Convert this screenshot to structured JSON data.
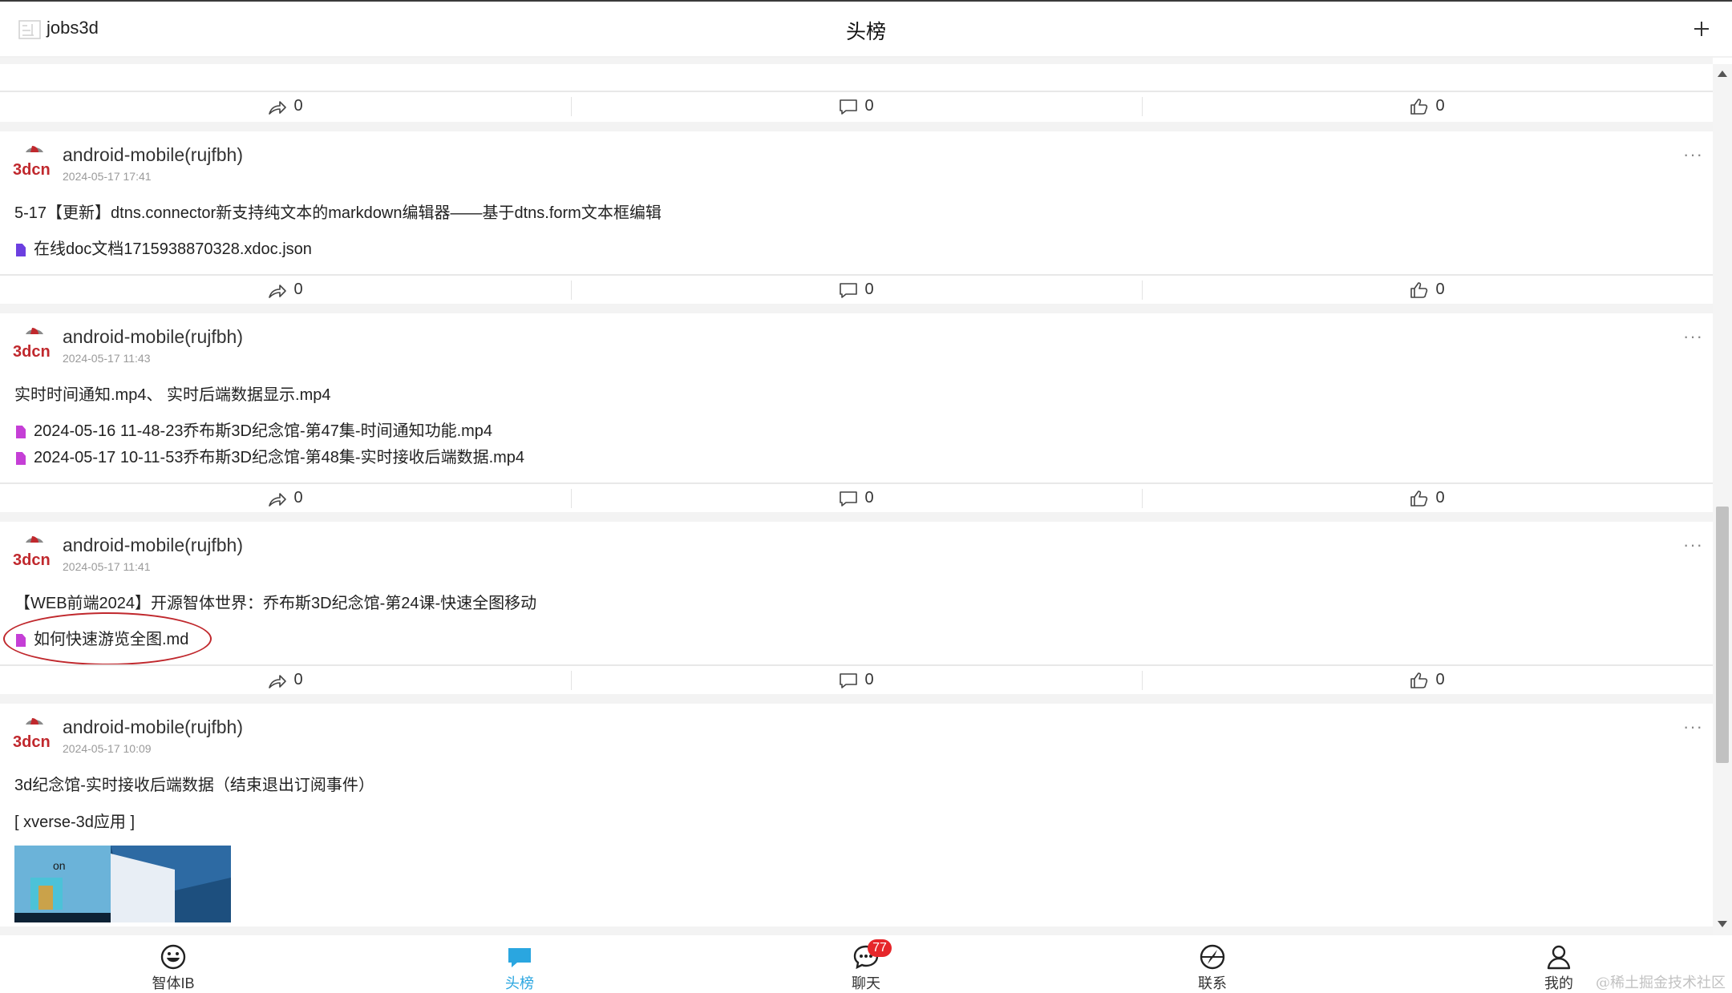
{
  "header": {
    "username": "jobs3d",
    "title": "头榜"
  },
  "avatar_brand": "3dcn",
  "feed": {
    "top_actions": {
      "forward": "0",
      "comment": "0",
      "like": "0"
    },
    "posts": [
      {
        "author": "android-mobile(rujfbh)",
        "time": "2024-05-17 17:41",
        "more": "···",
        "text": "5-17【更新】dtns.connector新支持纯文本的markdown编辑器——基于dtns.form文本框编辑",
        "files": [
          {
            "name": "在线doc文档1715938870328.xdoc.json",
            "kind": "doc"
          }
        ],
        "actions": {
          "forward": "0",
          "comment": "0",
          "like": "0"
        }
      },
      {
        "author": "android-mobile(rujfbh)",
        "time": "2024-05-17 11:43",
        "more": "···",
        "text": "实时时间通知.mp4、 实时后端数据显示.mp4",
        "files": [
          {
            "name": "2024-05-16 11-48-23乔布斯3D纪念馆-第47集-时间通知功能.mp4",
            "kind": "media"
          },
          {
            "name": "2024-05-17 10-11-53乔布斯3D纪念馆-第48集-实时接收后端数据.mp4",
            "kind": "media"
          }
        ],
        "actions": {
          "forward": "0",
          "comment": "0",
          "like": "0"
        }
      },
      {
        "author": "android-mobile(rujfbh)",
        "time": "2024-05-17 11:41",
        "more": "···",
        "text": "【WEB前端2024】开源智体世界：乔布斯3D纪念馆-第24课-快速全图移动",
        "files": [
          {
            "name": "如何快速游览全图.md",
            "kind": "media"
          }
        ],
        "actions": {
          "forward": "0",
          "comment": "0",
          "like": "0"
        }
      },
      {
        "author": "android-mobile(rujfbh)",
        "time": "2024-05-17 10:09",
        "more": "···",
        "text": "3d纪念馆-实时接收后端数据（结束退出订阅事件）",
        "tag": "[ xverse-3d应用 ]",
        "thumb_text": "on"
      }
    ]
  },
  "bottom_nav": [
    {
      "label": "智体IB",
      "icon": "smiley-icon"
    },
    {
      "label": "头榜",
      "icon": "chat-bubble-icon",
      "active": true
    },
    {
      "label": "聊天",
      "icon": "chat-icon",
      "badge": "77"
    },
    {
      "label": "联系",
      "icon": "compass-icon"
    },
    {
      "label": "我的",
      "icon": "user-icon"
    }
  ],
  "watermark": "@稀土掘金技术社区",
  "colors": {
    "accent": "#2aa6e0",
    "badge": "#e6262a",
    "brand_red": "#c0282d"
  }
}
